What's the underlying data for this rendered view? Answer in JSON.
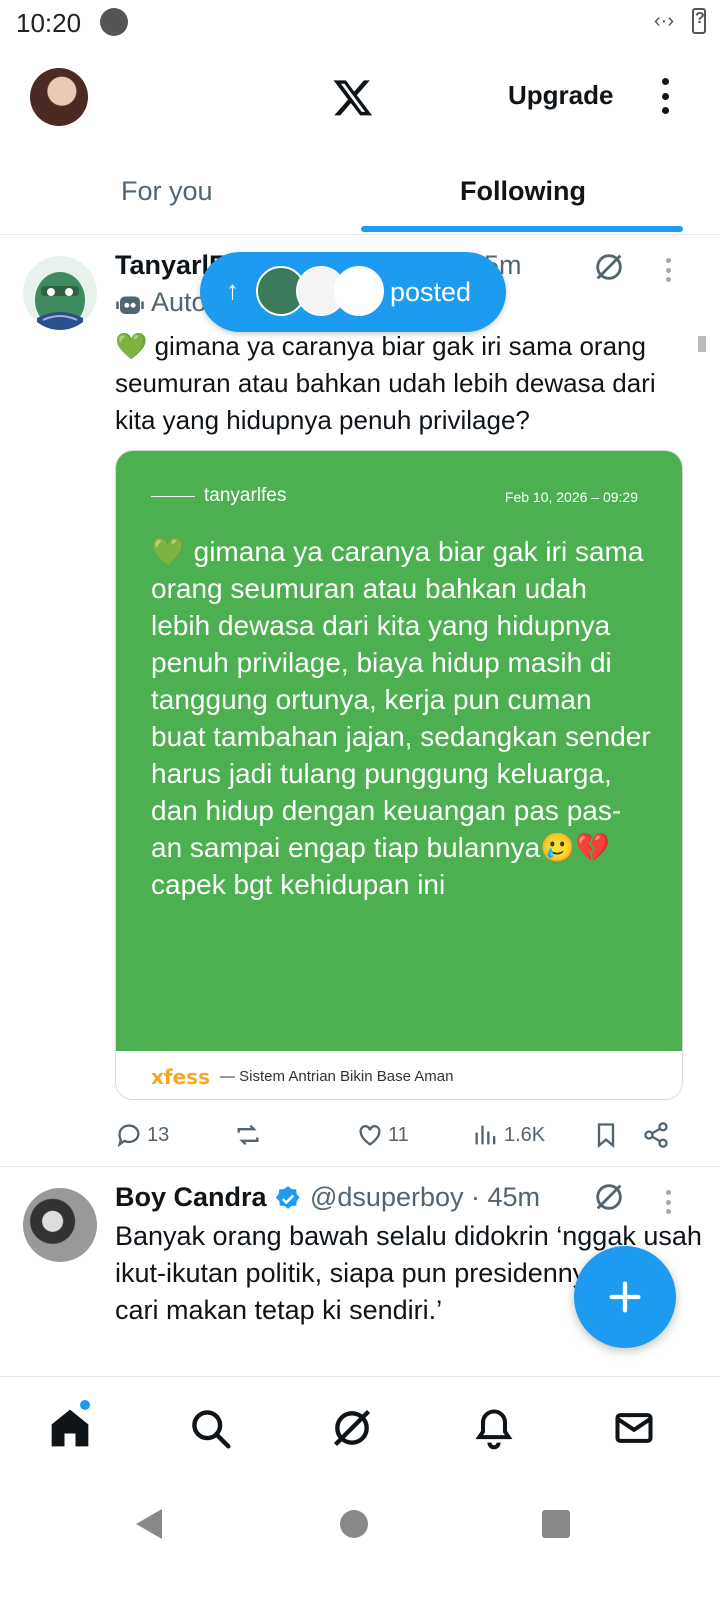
{
  "status_bar": {
    "time": "10:20"
  },
  "header": {
    "upgrade_label": "Upgrade"
  },
  "tabs": [
    {
      "label": "For you",
      "active": false
    },
    {
      "label": "Following",
      "active": true
    }
  ],
  "new_posts_pill": {
    "label": "posted"
  },
  "posts": [
    {
      "name": "TanyarlF",
      "time": "5m",
      "automated_label": "Auto",
      "text": "💚 gimana ya caranya biar gak iri sama orang seumuran atau bahkan udah lebih dewasa dari kita yang hidupnya penuh privilage?",
      "card": {
        "handle": "tanyarlfes",
        "date": "Feb 10, 2026 – 09:29",
        "text": "💚 gimana ya caranya biar gak iri sama orang seumuran atau bahkan udah lebih dewasa dari kita yang hidupnya penuh privilage, biaya hidup masih di tanggung ortunya, kerja pun cuman buat tambahan jajan, sedangkan sender harus jadi tulang punggung keluarga, dan hidup dengan keuangan pas pas-an sampai engap tiap bulannya🥲💔 capek bgt kehidupan ini",
        "brand": "xfess",
        "tagline": "— Sistem Antrian Bikin Base Aman"
      },
      "actions": {
        "replies": "13",
        "reposts": "",
        "likes": "11",
        "views": "1.6K"
      }
    },
    {
      "name": "Boy Candra",
      "handle_time": "@dsuperboy · 45m",
      "text": "Banyak orang bawah selalu didokrin ‘nggak usah ikut-ikutan politik, siapa pun presidennya yang cari makan tetap ki sendiri.’"
    }
  ],
  "colors": {
    "accent": "#1d9bf0",
    "card_green": "#4caf50",
    "xfess": "#f5a623"
  }
}
